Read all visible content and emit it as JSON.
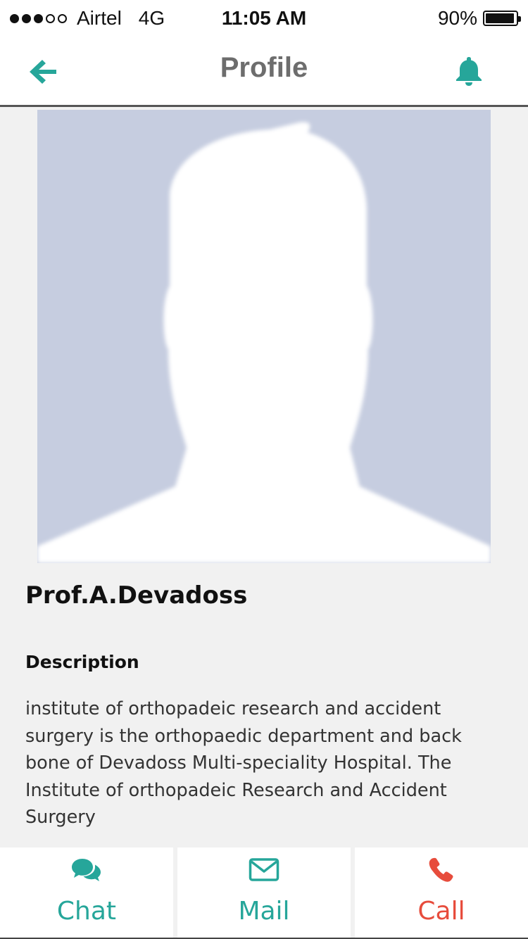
{
  "status_bar": {
    "carrier": "Airtel",
    "network": "4G",
    "time": "11:05 AM",
    "battery": "90%",
    "signal_bars_filled": 3,
    "signal_bars_total": 5
  },
  "header": {
    "title": "Profile",
    "back_icon": "arrow-left-icon",
    "notification_icon": "bell-icon"
  },
  "profile": {
    "avatar_icon": "default-person-silhouette",
    "name": "Prof.A.Devadoss",
    "description_heading": "Description",
    "description": "institute of orthopadeic research and accident surgery is the orthopaedic department and back bone of Devadoss Multi-speciality Hospital. The Institute of orthopadeic Research and Accident Surgery"
  },
  "actions": [
    {
      "label": "Chat",
      "icon": "chat-bubbles-icon",
      "color": "#26a69a"
    },
    {
      "label": "Mail",
      "icon": "envelope-icon",
      "color": "#26a69a"
    },
    {
      "label": "Call",
      "icon": "phone-icon",
      "color": "#e74c3c"
    }
  ],
  "colors": {
    "accent": "#26a69a",
    "call": "#e74c3c",
    "title_gray": "#6d6d6d",
    "avatar_bg": "#c6cde0"
  }
}
